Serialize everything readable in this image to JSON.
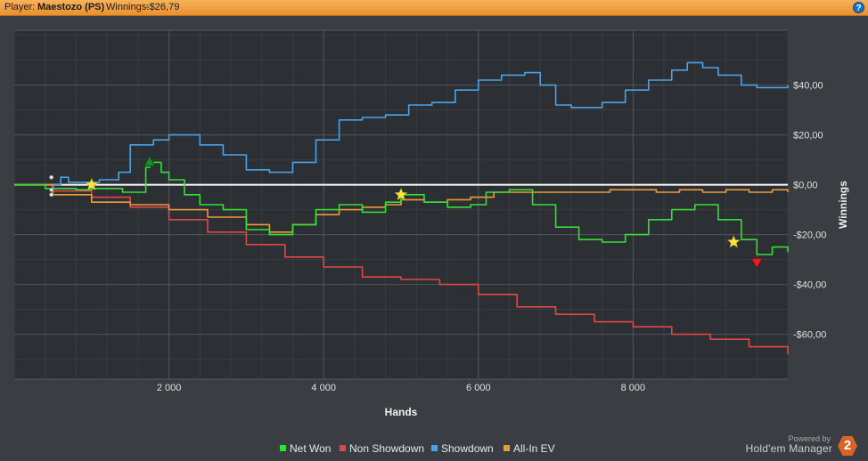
{
  "header": {
    "player_label": "Player:",
    "player_name": "Maestozo (PS)",
    "winnings_label": "Winnings:",
    "winnings_value": "-$26,79",
    "help_icon": "question-icon"
  },
  "footer": {
    "powered_by": "Powered by",
    "product": "Hold'em Manager",
    "logo_text": "2"
  },
  "chart_data": {
    "type": "line",
    "xlabel": "Hands",
    "ylabel": "Winnings",
    "xlim": [
      0,
      10000
    ],
    "ylim": [
      -78,
      62
    ],
    "x_ticks": [
      2000,
      4000,
      6000,
      8000
    ],
    "x_tick_labels": [
      "2 000",
      "4 000",
      "6 000",
      "8 000"
    ],
    "y_ticks": [
      40,
      20,
      0,
      -20,
      -40,
      -60
    ],
    "y_tick_labels": [
      "$40,00",
      "$20,00",
      "$0,00",
      "-$20,00",
      "-$40,00",
      "-$60,00"
    ],
    "grid": true,
    "legend_position": "bottom",
    "series": [
      {
        "name": "Net Won",
        "color": "#33e033",
        "x": [
          0,
          400,
          800,
          1000,
          1400,
          1700,
          1750,
          1900,
          2000,
          2200,
          2400,
          2700,
          3000,
          3300,
          3600,
          3900,
          4200,
          4500,
          4800,
          5000,
          5300,
          5600,
          5900,
          6100,
          6400,
          6700,
          7000,
          7300,
          7600,
          7900,
          8200,
          8500,
          8800,
          9100,
          9400,
          9600,
          9800,
          10000
        ],
        "y": [
          0,
          -1.5,
          -2,
          -1.5,
          -3,
          7,
          9,
          5,
          2,
          -4,
          -8,
          -10,
          -18,
          -20,
          -16,
          -10,
          -8,
          -11,
          -7,
          -4,
          -7,
          -9,
          -8,
          -3,
          -2,
          -8,
          -17,
          -22,
          -23,
          -20,
          -14,
          -10,
          -8,
          -14,
          -22,
          -28,
          -25,
          -27
        ]
      },
      {
        "name": "Non Showdown",
        "color": "#e04848",
        "x": [
          0,
          500,
          1000,
          1500,
          2000,
          2500,
          3000,
          3500,
          4000,
          4500,
          5000,
          5500,
          6000,
          6500,
          7000,
          7500,
          8000,
          8500,
          9000,
          9500,
          10000
        ],
        "y": [
          0,
          -2.5,
          -5,
          -9,
          -14,
          -19,
          -24,
          -29,
          -33,
          -37,
          -38,
          -40,
          -44,
          -49,
          -52,
          -55,
          -57,
          -60,
          -62,
          -65,
          -68
        ]
      },
      {
        "name": "Showdown",
        "color": "#4aa3e8",
        "x": [
          0,
          600,
          700,
          1100,
          1350,
          1500,
          1800,
          2000,
          2400,
          2700,
          3000,
          3300,
          3600,
          3900,
          4200,
          4500,
          4800,
          5100,
          5400,
          5700,
          6000,
          6300,
          6600,
          6800,
          7000,
          7200,
          7600,
          7900,
          8200,
          8500,
          8700,
          8900,
          9100,
          9400,
          9600,
          10000
        ],
        "y": [
          0,
          3,
          1,
          2,
          5,
          16,
          18,
          20,
          16,
          12,
          6,
          5,
          9,
          18,
          26,
          27,
          28,
          32,
          33,
          38,
          42,
          44,
          45,
          40,
          32,
          31,
          33,
          38,
          42,
          46,
          49,
          47,
          44,
          40,
          39,
          40
        ]
      },
      {
        "name": "All-In EV",
        "color": "#ee9a3a",
        "x": [
          0,
          500,
          1000,
          1500,
          2000,
          2500,
          3000,
          3300,
          3600,
          3900,
          4200,
          4500,
          4800,
          5000,
          5300,
          5600,
          5900,
          6200,
          6500,
          6800,
          7100,
          7400,
          7700,
          8000,
          8300,
          8600,
          8900,
          9200,
          9500,
          9800,
          10000
        ],
        "y": [
          0,
          -4,
          -7,
          -8,
          -10,
          -13,
          -16,
          -19,
          -16,
          -12,
          -10,
          -9,
          -8,
          -6,
          -7,
          -6,
          -5,
          -3,
          -3,
          -3,
          -3,
          -3,
          -2,
          -2,
          -3,
          -2,
          -3,
          -2,
          -3,
          -2,
          -3
        ]
      }
    ],
    "markers": [
      {
        "type": "star",
        "x": 1000,
        "y": 0,
        "color": "#f5e642"
      },
      {
        "type": "star",
        "x": 5000,
        "y": -4,
        "color": "#f5e642"
      },
      {
        "type": "star",
        "x": 9300,
        "y": -23,
        "color": "#f5e642"
      },
      {
        "type": "peak",
        "x": 1750,
        "y": 9,
        "color": "#1f8a2c"
      },
      {
        "type": "trough",
        "x": 9600,
        "y": -31,
        "color": "#e02222"
      }
    ]
  }
}
